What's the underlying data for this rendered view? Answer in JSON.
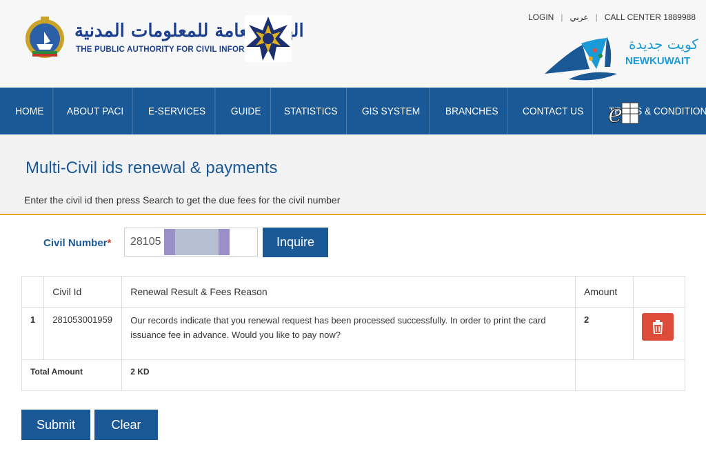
{
  "header": {
    "org_name_ar": "الهيئة العامة للمعلومات المدنية",
    "org_name_en": "THE PUBLIC AUTHORITY FOR CIVIL INFORMATION",
    "top_links": {
      "login": "LOGIN",
      "arabic": "عربي",
      "call_center": "CALL CENTER 1889988"
    },
    "new_kuwait_ar": "كويت جديدة",
    "new_kuwait_en": "NEWKUWAIT"
  },
  "nav": {
    "items": [
      "HOME",
      "ABOUT PACI",
      "E-SERVICES",
      "GUIDE",
      "STATISTICS",
      "GIS SYSTEM",
      "BRANCHES",
      "CONTACT US",
      "TERMS & CONDITIONS"
    ]
  },
  "page": {
    "title": "Multi-Civil ids renewal & payments",
    "subtitle": "Enter the civil id then press Search to get the due fees for the civil number"
  },
  "form": {
    "civil_number_label": "Civil Number",
    "required_mark": "*",
    "civil_number_value": "28105",
    "inquire_label": "Inquire"
  },
  "table": {
    "headers": {
      "num": "",
      "civil_id": "Civil Id",
      "reason": "Renewal Result & Fees Reason",
      "amount": "Amount",
      "action": ""
    },
    "rows": [
      {
        "num": "1",
        "civil_id": "281053001959",
        "reason": "Our records indicate that you renewal request has been processed successfully. In order to print the card issuance fee in advance. Would you like to pay now?",
        "amount": "2"
      }
    ],
    "total_label": "Total Amount",
    "total_value": "2 KD"
  },
  "actions": {
    "submit_label": "Submit",
    "clear_label": "Clear"
  },
  "colors": {
    "primary": "#1a5896",
    "accent": "#e6a817",
    "delete": "#dd4b39"
  },
  "icons": {
    "delete": "trash-icon",
    "eservices": "e-services-icon"
  }
}
